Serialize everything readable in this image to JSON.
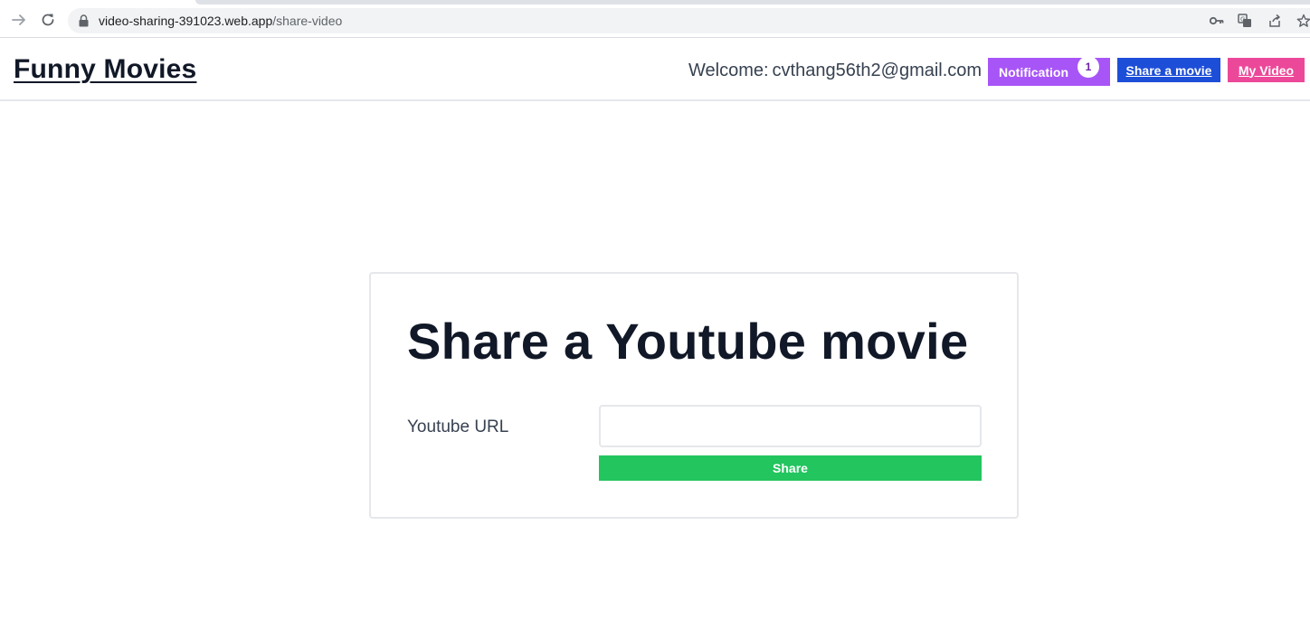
{
  "browser": {
    "url_host": "video-sharing-391023.web.app",
    "url_path": "/share-video",
    "icons": [
      "forward-icon",
      "reload-icon",
      "lock-icon",
      "key-icon",
      "translate-icon",
      "share-icon",
      "bookmark-star-icon"
    ]
  },
  "header": {
    "brand": "Funny Movies",
    "welcome_label": "Welcome:",
    "user_email": "cvthang56th2@gmail.com",
    "notification_label": "Notification",
    "notification_count": "1",
    "share_movie_label": "Share a movie",
    "my_video_label": "My Video"
  },
  "share_form": {
    "title": "Share a Youtube movie",
    "url_label": "Youtube URL",
    "url_value": "",
    "share_button_label": "Share"
  },
  "colors": {
    "notification_bg": "#a855f7",
    "share_movie_bg": "#1d4ed8",
    "my_video_bg": "#ec4899",
    "share_button_bg": "#22c55e",
    "title_text": "#111827"
  }
}
